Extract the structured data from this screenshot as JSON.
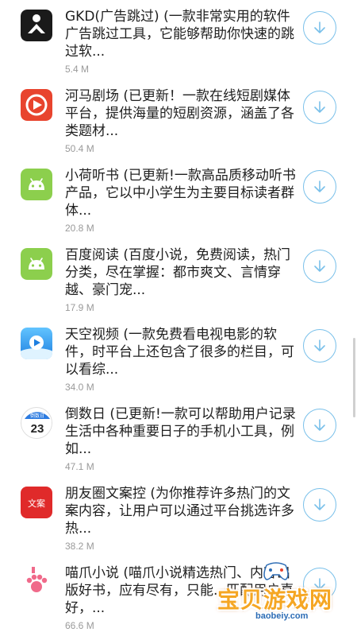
{
  "apps": [
    {
      "title": "GKD(广告跳过) (一款非常实用的软件广告跳过工具，它能够帮助你快速的跳过软...",
      "size": "5.4 M",
      "icon": "gkd-icon",
      "color": "#1a1a1a"
    },
    {
      "title": "河马剧场 (已更新！一款在线短剧媒体平台，提供海量的短剧资源，涵盖了各类题材...",
      "size": "50.4 M",
      "icon": "hippo-theater-icon",
      "color": "#e8442e"
    },
    {
      "title": "小荷听书 (已更新!一款高品质移动听书产品，它以中小学生为主要目标读者群体...",
      "size": "20.8 M",
      "icon": "android-icon",
      "color": "#8ccf4d"
    },
    {
      "title": "百度阅读 (百度小说，免费阅读，热门分类，尽在掌握：都市爽文、言情穿越、豪门宠...",
      "size": "17.9 M",
      "icon": "android-icon",
      "color": "#8ccf4d"
    },
    {
      "title": "天空视频 (一款免费看电视电影的软件，时平台上还包含了很多的栏目，可以看综...",
      "size": "34.0 M",
      "icon": "sky-video-icon",
      "color": "#3aa0f0"
    },
    {
      "title": "倒数日 (已更新!一款可以帮助用户记录生活中各种重要日子的手机小工具，例如...",
      "size": "47.1 M",
      "icon": "calendar-icon",
      "color": "#2c7be0"
    },
    {
      "title": "朋友圈文案控 (为你推荐许多热门的文案内容，让用户可以通过平台挑选许多热...",
      "size": "38.2 M",
      "icon": "copywriting-icon",
      "color": "#e02a2a"
    },
    {
      "title": "喵爪小说 (喵爪小说精选热门、内容出版好书，应有尽有，只能...匹配用户喜好，...",
      "size": "66.6 M",
      "icon": "cat-paw-icon",
      "color": "#f06a8a"
    }
  ],
  "calendar_icon_text": {
    "header": "倒数日",
    "day": "23"
  },
  "copy_icon_text": "文案",
  "watermark": {
    "text": "宝贝游戏网",
    "url": "baobeiy.com"
  }
}
